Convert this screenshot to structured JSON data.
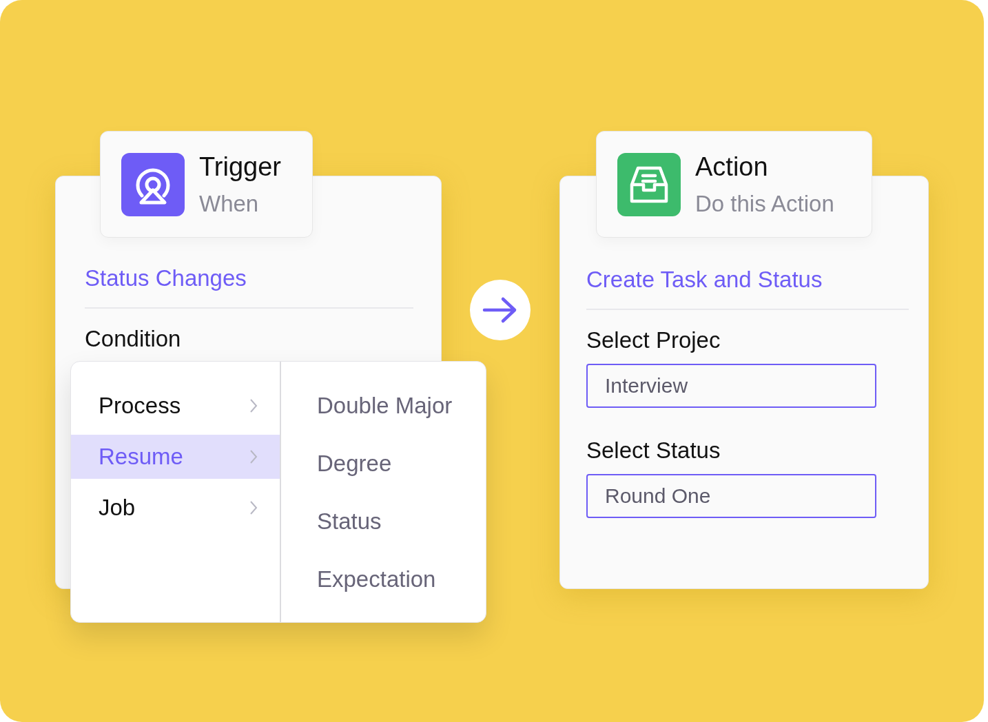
{
  "trigger": {
    "title": "Trigger",
    "subtitle": "When",
    "event": "Status Changes",
    "condition_label": "Condition",
    "categories": [
      {
        "label": "Process",
        "selected": false
      },
      {
        "label": "Resume",
        "selected": true
      },
      {
        "label": "Job",
        "selected": false
      }
    ],
    "fields": [
      "Double Major",
      "Degree",
      "Status",
      "Expectation"
    ]
  },
  "action": {
    "title": "Action",
    "subtitle": "Do this Action",
    "name": "Create Task and Status",
    "inputs": [
      {
        "label": "Select Projec",
        "value": "Interview"
      },
      {
        "label": "Select Status",
        "value": "Round One"
      }
    ]
  }
}
